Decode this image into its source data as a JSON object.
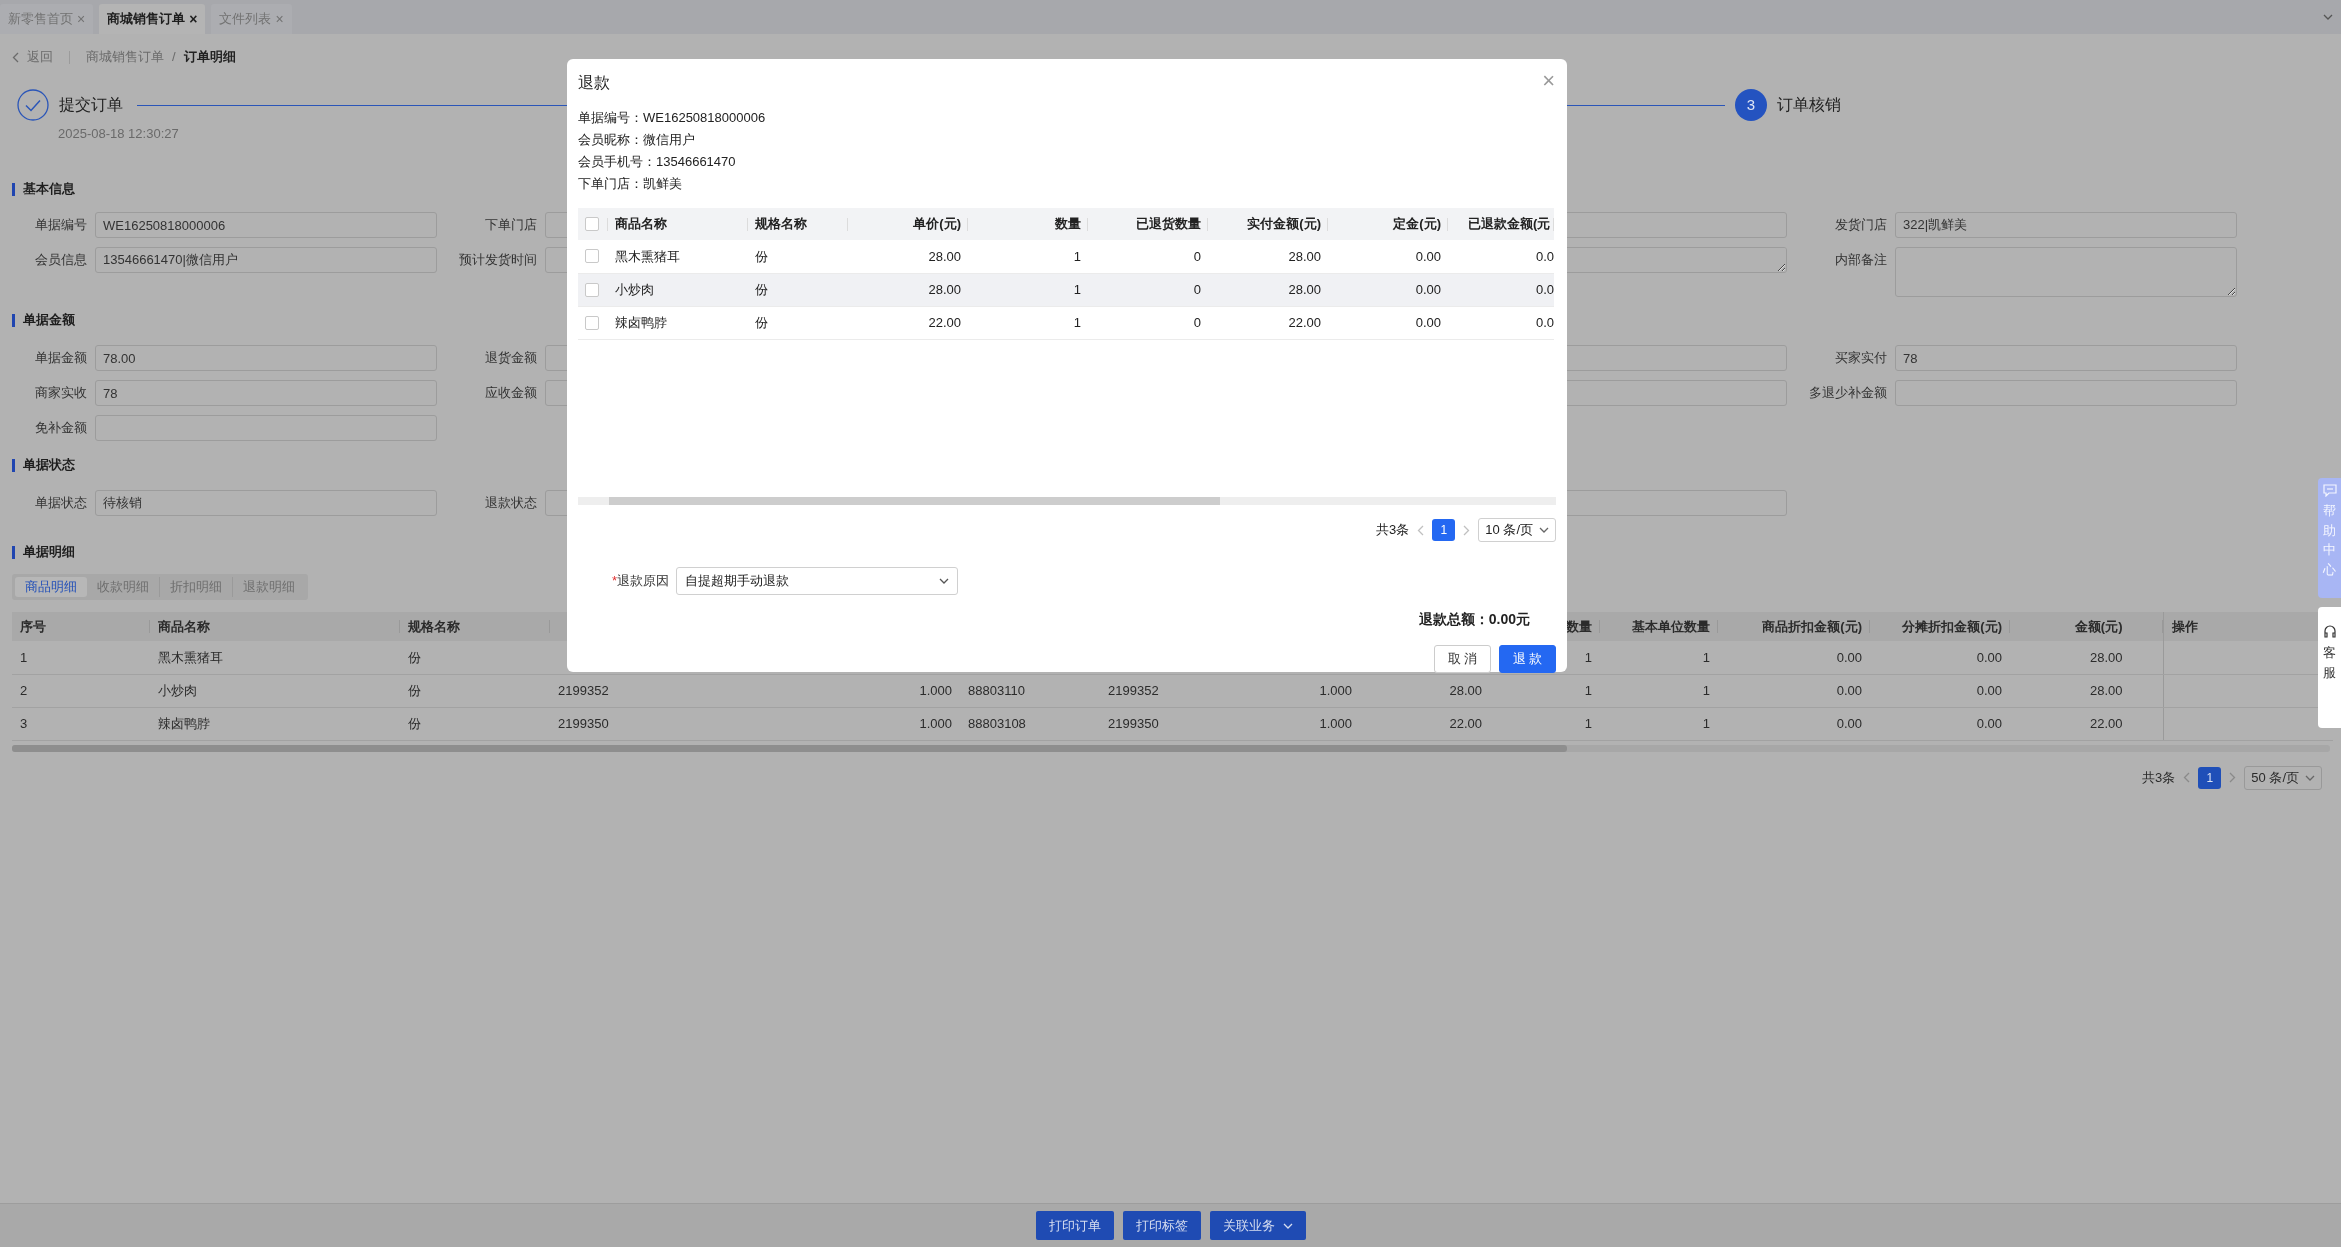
{
  "tabs": [
    {
      "label": "新零售首页",
      "close": "×",
      "selected": false
    },
    {
      "label": "商城销售订单",
      "close": "×",
      "selected": true
    },
    {
      "label": "文件列表",
      "close": "×",
      "selected": false
    }
  ],
  "breadcrumb": {
    "back": "返回",
    "items": [
      {
        "label": "商城销售订单",
        "current": false
      },
      {
        "label": "订单明细",
        "current": true
      }
    ],
    "separator": "/"
  },
  "steps": [
    {
      "kind": "done",
      "title": "提交订单",
      "time": "2025-08-18 12:30:27"
    },
    {
      "kind": "current",
      "number": "3",
      "title": "订单核销"
    }
  ],
  "sections": [
    {
      "title": "基本信息",
      "rows": [
        [
          {
            "label": "单据编号",
            "kind": "input",
            "value": "WE16250818000006"
          },
          {
            "label": "下单门店",
            "kind": "input"
          },
          null,
          {
            "kind": "input"
          },
          {
            "label": "发货门店",
            "kind": "input",
            "value": "322|凯鲜美"
          }
        ],
        [
          {
            "label": "会员信息",
            "kind": "input",
            "value": "13546661470|微信用户"
          },
          {
            "label": "预计发货时间",
            "kind": "input"
          },
          null,
          {
            "kind": "textarea"
          },
          {
            "label": "内部备注",
            "kind": "textarea"
          }
        ]
      ]
    },
    {
      "title": "单据金额",
      "rows": [
        [
          {
            "label": "单据金额",
            "kind": "input",
            "value": "78.00"
          },
          {
            "label": "退货金额",
            "kind": "input"
          },
          null,
          {
            "kind": "input"
          },
          {
            "label": "买家实付",
            "kind": "input",
            "value": "78"
          }
        ],
        [
          {
            "label": "商家实收",
            "kind": "input",
            "value": "78"
          },
          {
            "label": "应收金额",
            "kind": "input"
          },
          null,
          {
            "kind": "input"
          },
          {
            "label": "多退少补金额",
            "kind": "input"
          }
        ],
        [
          {
            "label": "免补金额",
            "kind": "input"
          },
          null,
          null,
          null,
          null
        ]
      ]
    },
    {
      "title": "单据状态",
      "rows": [
        [
          {
            "label": "单据状态",
            "kind": "input",
            "value": "待核销"
          },
          {
            "label": "退款状态",
            "kind": "input"
          },
          null,
          {
            "kind": "input"
          },
          null
        ]
      ]
    }
  ],
  "detail": {
    "title": "单据明细",
    "tabs": [
      {
        "label": "商品明细",
        "selected": true
      },
      {
        "label": "收款明细",
        "selected": false
      },
      {
        "label": "折扣明细",
        "selected": false
      },
      {
        "label": "退款明细",
        "selected": false
      }
    ],
    "table": {
      "columns": [
        "序号",
        "商品名称",
        "规格名称",
        null,
        null,
        null,
        null,
        null,
        null,
        "数量",
        "基本单位数量",
        "商品折扣金额(元)",
        "分摊折扣金额(元)",
        "金额(元)",
        "操作"
      ],
      "rows": [
        {
          "cells": [
            "1",
            "黑木熏猪耳",
            "份",
            null,
            null,
            null,
            null,
            null,
            null,
            "1",
            "1",
            "0.00",
            "0.00",
            "28.00",
            null
          ]
        },
        {
          "cells": [
            "2",
            "小炒肉",
            "份",
            "2199352",
            "1.000",
            "88803110",
            "2199352",
            "1.000",
            "28.00",
            "1",
            "1",
            "0.00",
            "0.00",
            "28.00",
            null
          ]
        },
        {
          "cells": [
            "3",
            "辣卤鸭脖",
            "份",
            "2199350",
            "1.000",
            "88803108",
            "2199350",
            "1.000",
            "22.00",
            "1",
            "1",
            "0.00",
            "0.00",
            "22.00",
            null
          ]
        }
      ]
    },
    "pagination": {
      "total": "共3条",
      "pages": [
        {
          "label": "1",
          "selected": true
        }
      ],
      "page_size": "50 条/页"
    }
  },
  "modal": {
    "title": "退款",
    "close": "×",
    "info": [
      "单据编号：WE16250818000006",
      "会员昵称：微信用户",
      "会员手机号：13546661470",
      "下单门店：凯鲜美"
    ],
    "table": {
      "select_all": {
        "checked": false
      },
      "columns": [
        "商品名称",
        "规格名称",
        "单价(元)",
        "数量",
        "已退货数量",
        "实付金额(元)",
        "定金(元)",
        "已退款金额(元"
      ],
      "rows": [
        {
          "checked": false,
          "highlighted": false,
          "cells": [
            "黑木熏猪耳",
            "份",
            "28.00",
            "1",
            "0",
            "28.00",
            "0.00",
            "0.0"
          ]
        },
        {
          "checked": false,
          "highlighted": true,
          "cells": [
            "小炒肉",
            "份",
            "28.00",
            "1",
            "0",
            "28.00",
            "0.00",
            "0.0"
          ]
        },
        {
          "checked": false,
          "highlighted": false,
          "cells": [
            "辣卤鸭脖",
            "份",
            "22.00",
            "1",
            "0",
            "22.00",
            "0.00",
            "0.0"
          ]
        }
      ]
    },
    "pagination": {
      "total": "共3条",
      "pages": [
        {
          "label": "1",
          "selected": true
        }
      ],
      "page_size": "10 条/页"
    },
    "reason": {
      "required_mark": "*",
      "label": "退款原因",
      "value": "自提超期手动退款"
    },
    "total": "退款总额：0.00元",
    "buttons": [
      {
        "label": "取 消",
        "kind": "default"
      },
      {
        "label": "退 款",
        "kind": "primary"
      }
    ]
  },
  "side": {
    "help": "帮助中心",
    "service": "客服"
  },
  "footer": [
    {
      "label": "打印订单",
      "dropdown": false
    },
    {
      "label": "打印标签",
      "dropdown": false
    },
    {
      "label": "关联业务",
      "dropdown": true
    }
  ]
}
